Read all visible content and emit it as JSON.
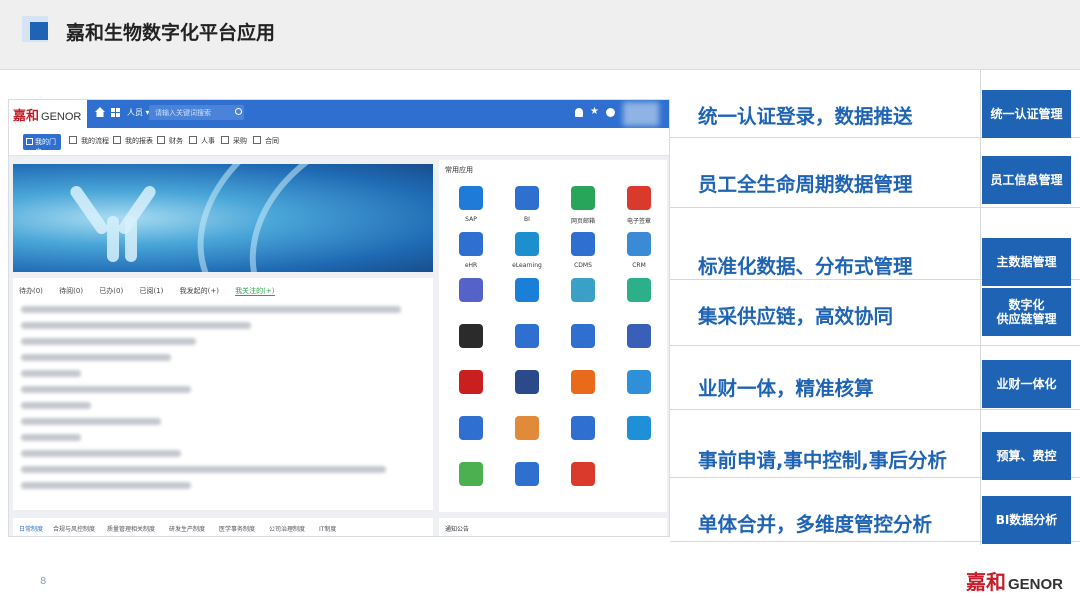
{
  "slide": {
    "title": "嘉和生物数字化平台应用",
    "page_number": "8",
    "logo_cn": "嘉和",
    "logo_en": "GENOR"
  },
  "portal": {
    "logo_cn": "嘉和",
    "logo_en": "GENOR",
    "nav": {
      "select_label": "人员 ▾",
      "search_placeholder": "请输入关键词搜索"
    },
    "tabs": [
      "我的门户",
      "我的流程",
      "我的报表",
      "财务",
      "人事",
      "采购",
      "合同"
    ],
    "task_tabs": [
      "待办(0)",
      "待阅(0)",
      "已办(0)",
      "已阅(1)",
      "我发起的(+)",
      "我关注的(+)"
    ],
    "bottom_tabs": [
      "日常制度",
      "合规与风控制度",
      "质量管理相关制度",
      "研发生产制度",
      "医学事务制度",
      "公司治理制度",
      "IT制度"
    ],
    "apps_title": "常用应用",
    "apps": [
      {
        "label": "SAP",
        "color": "#1f7bd8",
        "icon": "sap-icon"
      },
      {
        "label": "BI",
        "color": "#2f6fd0",
        "icon": "bi-chart-icon"
      },
      {
        "label": "网页邮箱",
        "color": "#27a55a",
        "icon": "mail-icon"
      },
      {
        "label": "电子签章",
        "color": "#d93a2b",
        "icon": "stamp-icon"
      },
      {
        "label": "eHR",
        "color": "#2f6fd0",
        "icon": "person-icon"
      },
      {
        "label": "eLearning",
        "color": "#1d8fcf",
        "icon": "elearning-icon"
      },
      {
        "label": "CDMS",
        "color": "#2f6fd0",
        "icon": "cdms-icon"
      },
      {
        "label": "CRM",
        "color": "#3b8ad6",
        "icon": "crm-icon"
      },
      {
        "label": "",
        "color": "#5563c9",
        "icon": "document-icon"
      },
      {
        "label": "",
        "color": "#1a7fd8",
        "icon": "cloud-icon"
      },
      {
        "label": "",
        "color": "#3aa0c8",
        "icon": "inbox-icon"
      },
      {
        "label": "",
        "color": "#2bb08a",
        "icon": "cube-icon"
      },
      {
        "label": "",
        "color": "#2b2b2b",
        "icon": "arrow-app-icon"
      },
      {
        "label": "",
        "color": "#2f6fd0",
        "icon": "fingerprint-icon"
      },
      {
        "label": "",
        "color": "#2f6fd0",
        "icon": "workflow-icon"
      },
      {
        "label": "",
        "color": "#3a5fb8",
        "icon": "wave-icon"
      },
      {
        "label": "",
        "color": "#c9201f",
        "icon": "circuit-icon"
      },
      {
        "label": "",
        "color": "#2a4a8a",
        "icon": "server-icon"
      },
      {
        "label": "",
        "color": "#e86a1a",
        "icon": "bracket-icon"
      },
      {
        "label": "",
        "color": "#2f8fd8",
        "icon": "cloud-lock-icon"
      },
      {
        "label": "",
        "color": "#2f6fd0",
        "icon": "globe-icon"
      },
      {
        "label": "",
        "color": "#e08a3a",
        "icon": "network-icon"
      },
      {
        "label": "",
        "color": "#2f6fd0",
        "icon": "shield-icon"
      },
      {
        "label": "",
        "color": "#1f8fd8",
        "icon": "lock-icon"
      },
      {
        "label": "",
        "color": "#4caf50",
        "icon": "tools-icon"
      },
      {
        "label": "",
        "color": "#2f6fd0",
        "icon": "doc-a-icon"
      },
      {
        "label": "",
        "color": "#d93a2b",
        "icon": "refresh-doc-icon"
      }
    ],
    "notice_title": "通知公告"
  },
  "features": [
    {
      "text": "统一认证登录，数据推送",
      "button": "统一认证管理"
    },
    {
      "text": "员工全生命周期数据管理",
      "button": "员工信息管理"
    },
    {
      "text": "标准化数据、分布式管理",
      "button": "主数据管理"
    },
    {
      "text": "集采供应链，高效协同",
      "button": "数字化\n供应链管理"
    },
    {
      "text": "业财一体，精准核算",
      "button": "业财一体化"
    },
    {
      "text": "事前申请,事中控制,事后分析",
      "button": "预算、费控"
    },
    {
      "text": "单体合并，多维度管控分析",
      "button": "BI数据分析"
    }
  ],
  "colors": {
    "accent": "#1f64b4",
    "portal_blue": "#2f6fd0",
    "brand_red": "#c51f2b"
  }
}
